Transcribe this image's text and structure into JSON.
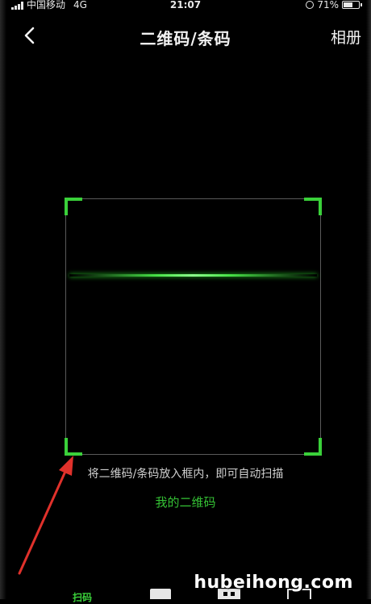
{
  "status_bar": {
    "carrier": "中国移动",
    "network": "4G",
    "time": "21:07",
    "battery": "71%",
    "battery_level": 0.71
  },
  "nav": {
    "title": "二维码/条码",
    "album_label": "相册",
    "back_icon": "chevron-left-icon"
  },
  "scanner": {
    "hint": "将二维码/条码放入框内，即可自动扫描",
    "my_qrcode_label": "我的二维码",
    "accent_color": "#3ad13a"
  },
  "tabs": [
    {
      "label": "扫码",
      "icon": "qrcode-icon",
      "active": true
    },
    {
      "icon": "cover-icon",
      "active": false
    },
    {
      "icon": "street-view-icon",
      "active": false
    },
    {
      "icon": "translate-icon",
      "active": false
    }
  ],
  "annotation": {
    "color": "#e0312b"
  },
  "watermark": "hubeihong.com"
}
